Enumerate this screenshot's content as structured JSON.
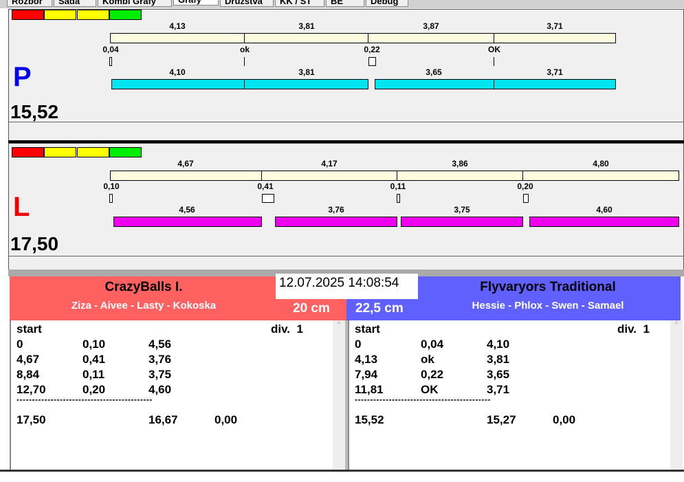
{
  "tabs": [
    "Rozbor",
    "Sada",
    "Kombi Grafy",
    "Grafy",
    "Družstva",
    "KK / ST",
    "BE",
    "Debug"
  ],
  "signal_colors": [
    "#ff0000",
    "#ffff00",
    "#ffff00",
    "#00ee00"
  ],
  "p": {
    "letter": "P",
    "score": "15,52",
    "top": [
      "4,13",
      "3,81",
      "3,87",
      "3,71"
    ],
    "mid": [
      "0,04",
      "ok",
      "0,22",
      "OK"
    ],
    "bottom": [
      "4,10",
      "3,81",
      "3,65",
      "3,71"
    ],
    "color": "#00e5f0"
  },
  "l": {
    "letter": "L",
    "score": "17,50",
    "top": [
      "4,67",
      "4,17",
      "3,86",
      "4,80"
    ],
    "mid": [
      "0,10",
      "0,41",
      "0,11",
      "0,20"
    ],
    "bottom": [
      "4,56",
      "3,76",
      "3,75",
      "4,60"
    ],
    "color": "#ee00ee"
  },
  "datetime": "12.07.2025 14:08:54",
  "left_team": {
    "name": "CrazyBalls I.",
    "players": "Ziza - Aivee - Lasty - Kokoska",
    "distance": "20 cm",
    "color": "#ff6060",
    "header": [
      "start",
      "div.  1"
    ],
    "rows": [
      [
        "0",
        "0,10",
        "4,56"
      ],
      [
        "4,67",
        "0,41",
        "3,76"
      ],
      [
        "8,84",
        "0,11",
        "3,75"
      ],
      [
        "12,70",
        "0,20",
        "4,60"
      ]
    ],
    "separator": "--------------------------------------------",
    "totals": [
      "17,50",
      "16,67",
      "0,00"
    ]
  },
  "right_team": {
    "name": "Flyvaryors Traditional",
    "players": "Hessie - Phlox - Swen - Samael",
    "distance": "22,5 cm",
    "color": "#6060ff",
    "header": [
      "start",
      "div.  1"
    ],
    "rows": [
      [
        "0",
        "0,04",
        "4,10"
      ],
      [
        "4,13",
        "ok",
        "3,81"
      ],
      [
        "7,94",
        "0,22",
        "3,65"
      ],
      [
        "11,81",
        "OK",
        "3,71"
      ]
    ],
    "separator": "--------------------------------------------",
    "totals": [
      "15,52",
      "15,27",
      "0,00"
    ]
  }
}
